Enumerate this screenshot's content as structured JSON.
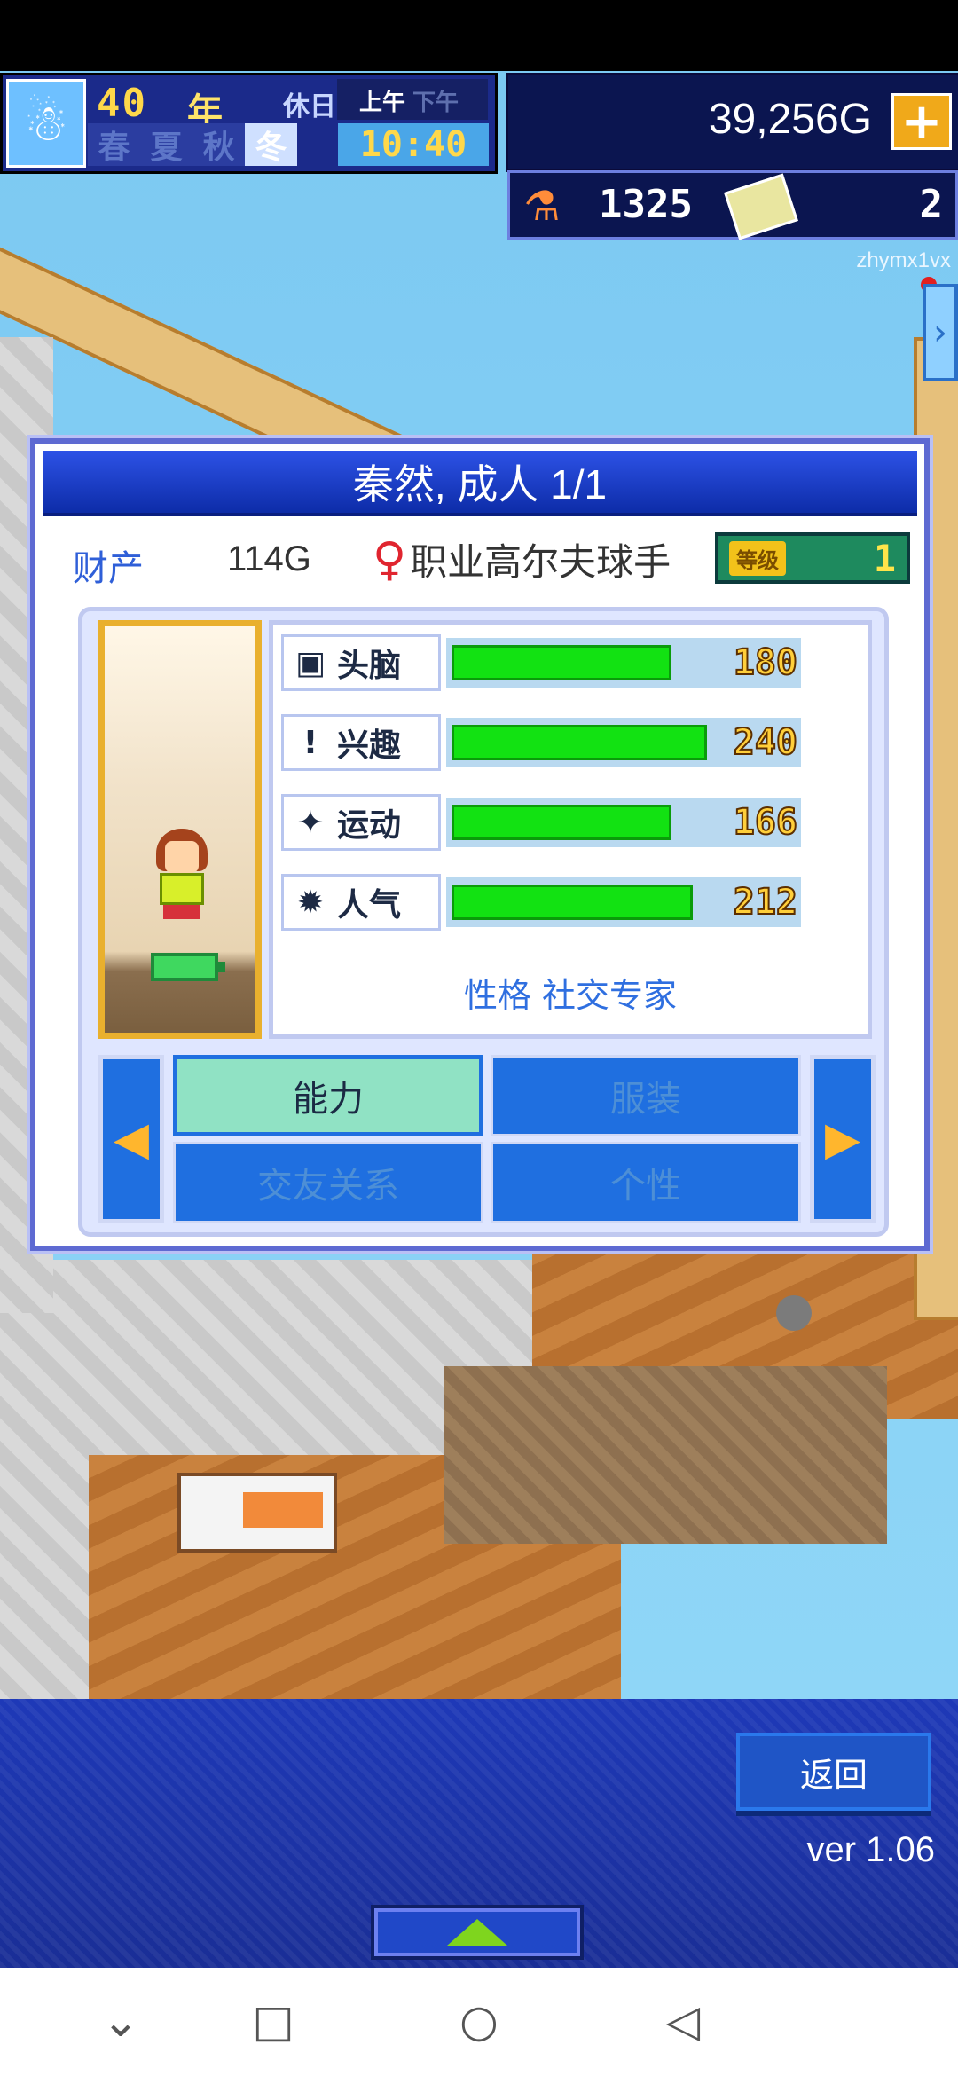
{
  "hud": {
    "year": "40",
    "year_unit": "年",
    "holiday": "休日",
    "am": "上午",
    "pm": "下午",
    "seasons": [
      "春",
      "夏",
      "秋",
      "冬"
    ],
    "active_season": "冬",
    "time": "10:40",
    "money": "39,256G",
    "money_plus_icon": "plus-icon",
    "research_points": "1325",
    "tickets": "2",
    "user_id": "zhymx1vx"
  },
  "panel": {
    "title": "秦然, 成人 1/1",
    "asset_label": "财产",
    "asset_value": "114G",
    "gender_icon": "♀",
    "job": "职业高尔夫球手",
    "level_label": "等级",
    "level_value": "1",
    "stats": [
      {
        "label": "头脑",
        "value": "180",
        "fill": 0.62,
        "icon": "brain-icon",
        "glyph": "▣"
      },
      {
        "label": "兴趣",
        "value": "240",
        "fill": 0.72,
        "icon": "interest-icon",
        "glyph": "!"
      },
      {
        "label": "运动",
        "value": "166",
        "fill": 0.62,
        "icon": "sport-icon",
        "glyph": "✦"
      },
      {
        "label": "人气",
        "value": "212",
        "fill": 0.68,
        "icon": "popularity-icon",
        "glyph": "✹"
      }
    ],
    "personality_label": "性格",
    "personality_value": "社交专家",
    "tabs": {
      "ability": "能力",
      "outfit": "服装",
      "friends": "交友关系",
      "character": "个性"
    },
    "active_tab": "能力"
  },
  "bottom": {
    "back_label": "返回",
    "version": "ver 1.06"
  },
  "colors": {
    "panel_title_bg": "#1d3fd0",
    "stat_bar": "#12e212",
    "tab_active": "#90e2c4",
    "tab_inactive": "#1f6fe0"
  }
}
